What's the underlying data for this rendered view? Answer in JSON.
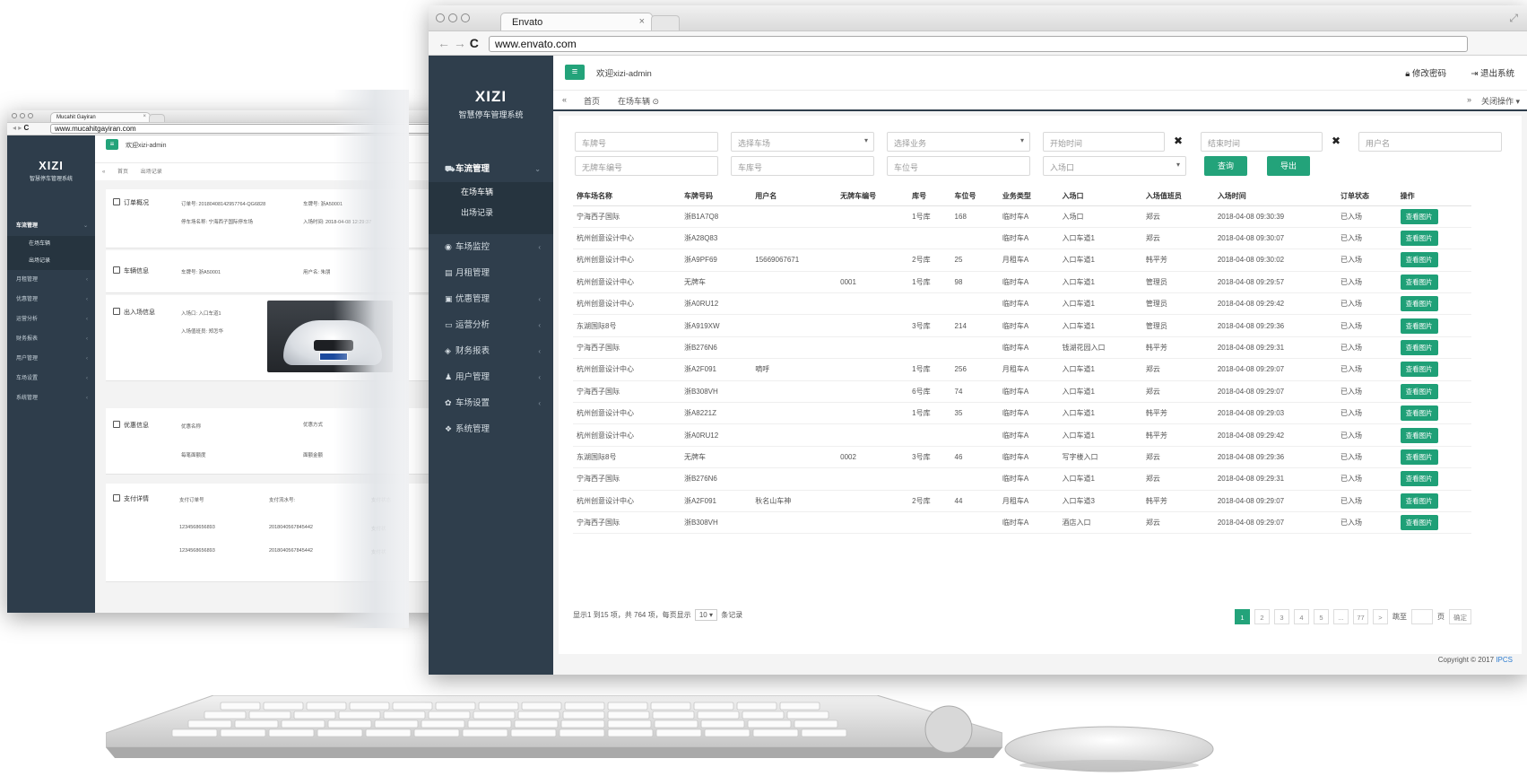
{
  "back_window": {
    "tab_title": "Mucahit Gayiran",
    "url": "www.mucahitgayiran.com",
    "logo": "XIZI",
    "logo_sub": "智慧停车管理系统",
    "welcome": "欢迎xizi-admin",
    "crumbs": [
      "首页",
      "出场记录"
    ],
    "menu": [
      {
        "label": "车流管理",
        "current": true
      },
      {
        "label": "月租管理"
      },
      {
        "label": "优惠管理"
      },
      {
        "label": "运营分析"
      },
      {
        "label": "财务报表"
      },
      {
        "label": "用户管理"
      },
      {
        "label": "车场设置"
      },
      {
        "label": "系统管理"
      }
    ],
    "submenu": [
      "在场车辆",
      "出场记录"
    ],
    "sections": {
      "order": {
        "label": "订单概况",
        "order_no": "订单号: 20180408142957764-QG6828",
        "plate": "车牌号: 浙A50001",
        "lot": "停车场名称: 宁海西子国际停车场",
        "in_time": "入场时间: 2018-04-08 12:29:37"
      },
      "car": {
        "label": "车辆信息",
        "plate": "车牌号: 浙A50001",
        "user": "用户名: 朱朋"
      },
      "io": {
        "label": "出入场信息",
        "gate": "入场口: 入口车道1",
        "operator": "入场值班员: 郑怎华"
      },
      "discount": {
        "label": "优惠信息",
        "name": "优惠名称",
        "type": "优惠方式",
        "amount": "每笔面额度",
        "value": "面额金额"
      },
      "pay": {
        "label": "支付详情",
        "col1": "支付订单号",
        "col2": "支付流水号:",
        "col3": "支付状态",
        "rows": [
          [
            "1234568656893",
            "2018040567845442",
            "支付状"
          ],
          [
            "1234568656893",
            "2018040567845442",
            "支付状"
          ]
        ]
      }
    }
  },
  "browser": {
    "tab_title": "Envato",
    "url": "www.envato.com"
  },
  "app": {
    "logo": "XIZI",
    "logo_sub": "智慧停车管理系统",
    "welcome": "欢迎xizi-admin",
    "change_pwd": "修改密码",
    "logout": "退出系统",
    "crumb_home": "首页",
    "crumb_current": "在场车辆",
    "close_ops": "关闭操作"
  },
  "sidebar": {
    "items": [
      {
        "label": "车流管理",
        "icon": "car-icon",
        "current": true
      },
      {
        "label": "车场监控",
        "icon": "monitor-icon"
      },
      {
        "label": "月租管理",
        "icon": "calendar-icon"
      },
      {
        "label": "优惠管理",
        "icon": "ticket-icon"
      },
      {
        "label": "运营分析",
        "icon": "chart-icon"
      },
      {
        "label": "财务报表",
        "icon": "money-icon"
      },
      {
        "label": "用户管理",
        "icon": "user-icon"
      },
      {
        "label": "车场设置",
        "icon": "settings-icon"
      },
      {
        "label": "系统管理",
        "icon": "system-icon"
      }
    ],
    "sub_items": [
      "在场车辆",
      "出场记录"
    ]
  },
  "filters": {
    "plate": "车牌号",
    "lot": "选择车场",
    "business": "选择业务",
    "start_time": "开始时间",
    "end_time": "结束时间",
    "username": "用户名",
    "no_plate": "无牌车编号",
    "garage": "车库号",
    "spot": "车位号",
    "gate": "入场口",
    "query": "查询",
    "export": "导出"
  },
  "table": {
    "headers": [
      "停车场名称",
      "车牌号码",
      "用户名",
      "无牌车编号",
      "库号",
      "车位号",
      "业务类型",
      "入场口",
      "入场值班员",
      "入场时间",
      "订单状态",
      "操作"
    ],
    "action_label": "查看图片",
    "rows": [
      [
        "宁海西子国际",
        "浙B1A7Q8",
        "",
        "",
        "1号库",
        "168",
        "临时车A",
        "入场口",
        "郑云",
        "2018-04-08 09:30:39",
        "已入场"
      ],
      [
        "杭州创意设计中心",
        "浙A28Q83",
        "",
        "",
        "",
        "",
        "临时车A",
        "入口车道1",
        "郑云",
        "2018-04-08 09:30:07",
        "已入场"
      ],
      [
        "杭州创意设计中心",
        "浙A9PF69",
        "15669067671",
        "",
        "2号库",
        "25",
        "月租车A",
        "入口车道1",
        "韩平芳",
        "2018-04-08 09:30:02",
        "已入场"
      ],
      [
        "杭州创意设计中心",
        "无牌车",
        "",
        "0001",
        "1号库",
        "98",
        "临时车A",
        "入口车道1",
        "管理员",
        "2018-04-08 09:29:57",
        "已入场"
      ],
      [
        "杭州创意设计中心",
        "浙A0RU12",
        "",
        "",
        "",
        "",
        "临时车A",
        "入口车道1",
        "管理员",
        "2018-04-08 09:29:42",
        "已入场"
      ],
      [
        "东湖国际8号",
        "浙A919XW",
        "",
        "",
        "3号库",
        "214",
        "临时车A",
        "入口车道1",
        "管理员",
        "2018-04-08 09:29:36",
        "已入场"
      ],
      [
        "宁海西子国际",
        "浙B276N6",
        "",
        "",
        "",
        "",
        "临时车A",
        "钱湖花园入口",
        "韩平芳",
        "2018-04-08 09:29:31",
        "已入场"
      ],
      [
        "杭州创意设计中心",
        "浙A2F091",
        "嘀呼",
        "",
        "1号库",
        "256",
        "月租车A",
        "入口车道1",
        "郑云",
        "2018-04-08 09:29:07",
        "已入场"
      ],
      [
        "宁海西子国际",
        "浙B308VH",
        "",
        "",
        "6号库",
        "74",
        "临时车A",
        "入口车道1",
        "郑云",
        "2018-04-08 09:29:07",
        "已入场"
      ],
      [
        "杭州创意设计中心",
        "浙A8221Z",
        "",
        "",
        "1号库",
        "35",
        "临时车A",
        "入口车道1",
        "韩平芳",
        "2018-04-08 09:29:03",
        "已入场"
      ],
      [
        "杭州创意设计中心",
        "浙A0RU12",
        "",
        "",
        "",
        "",
        "临时车A",
        "入口车道1",
        "韩平芳",
        "2018-04-08 09:29:42",
        "已入场"
      ],
      [
        "东湖国际8号",
        "无牌车",
        "",
        "0002",
        "3号库",
        "46",
        "临时车A",
        "写字楼入口",
        "郑云",
        "2018-04-08 09:29:36",
        "已入场"
      ],
      [
        "宁海西子国际",
        "浙B276N6",
        "",
        "",
        "",
        "",
        "临时车A",
        "入口车道1",
        "郑云",
        "2018-04-08 09:29:31",
        "已入场"
      ],
      [
        "杭州创意设计中心",
        "浙A2F091",
        "秋名山车神",
        "",
        "2号库",
        "44",
        "月租车A",
        "入口车道3",
        "韩平芳",
        "2018-04-08 09:29:07",
        "已入场"
      ],
      [
        "宁海西子国际",
        "浙B308VH",
        "",
        "",
        "",
        "",
        "临时车A",
        "酒店入口",
        "郑云",
        "2018-04-08 09:29:07",
        "已入场"
      ]
    ]
  },
  "pagination": {
    "summary": "显示1 到15 项，共 764 项，每页显示",
    "per_page": "10",
    "records": "条记录",
    "pages": [
      "1",
      "2",
      "3",
      "4",
      "5",
      "...",
      "77"
    ],
    "next": ">",
    "goto": "跳至",
    "page_unit": "页",
    "confirm": "确定"
  },
  "copyright": {
    "text": "Copyright © 2017",
    "brand": "IPCS"
  },
  "colors": {
    "accent": "#23a37a",
    "sidebar": "#2f3e4c",
    "link": "#2b7bd0"
  }
}
